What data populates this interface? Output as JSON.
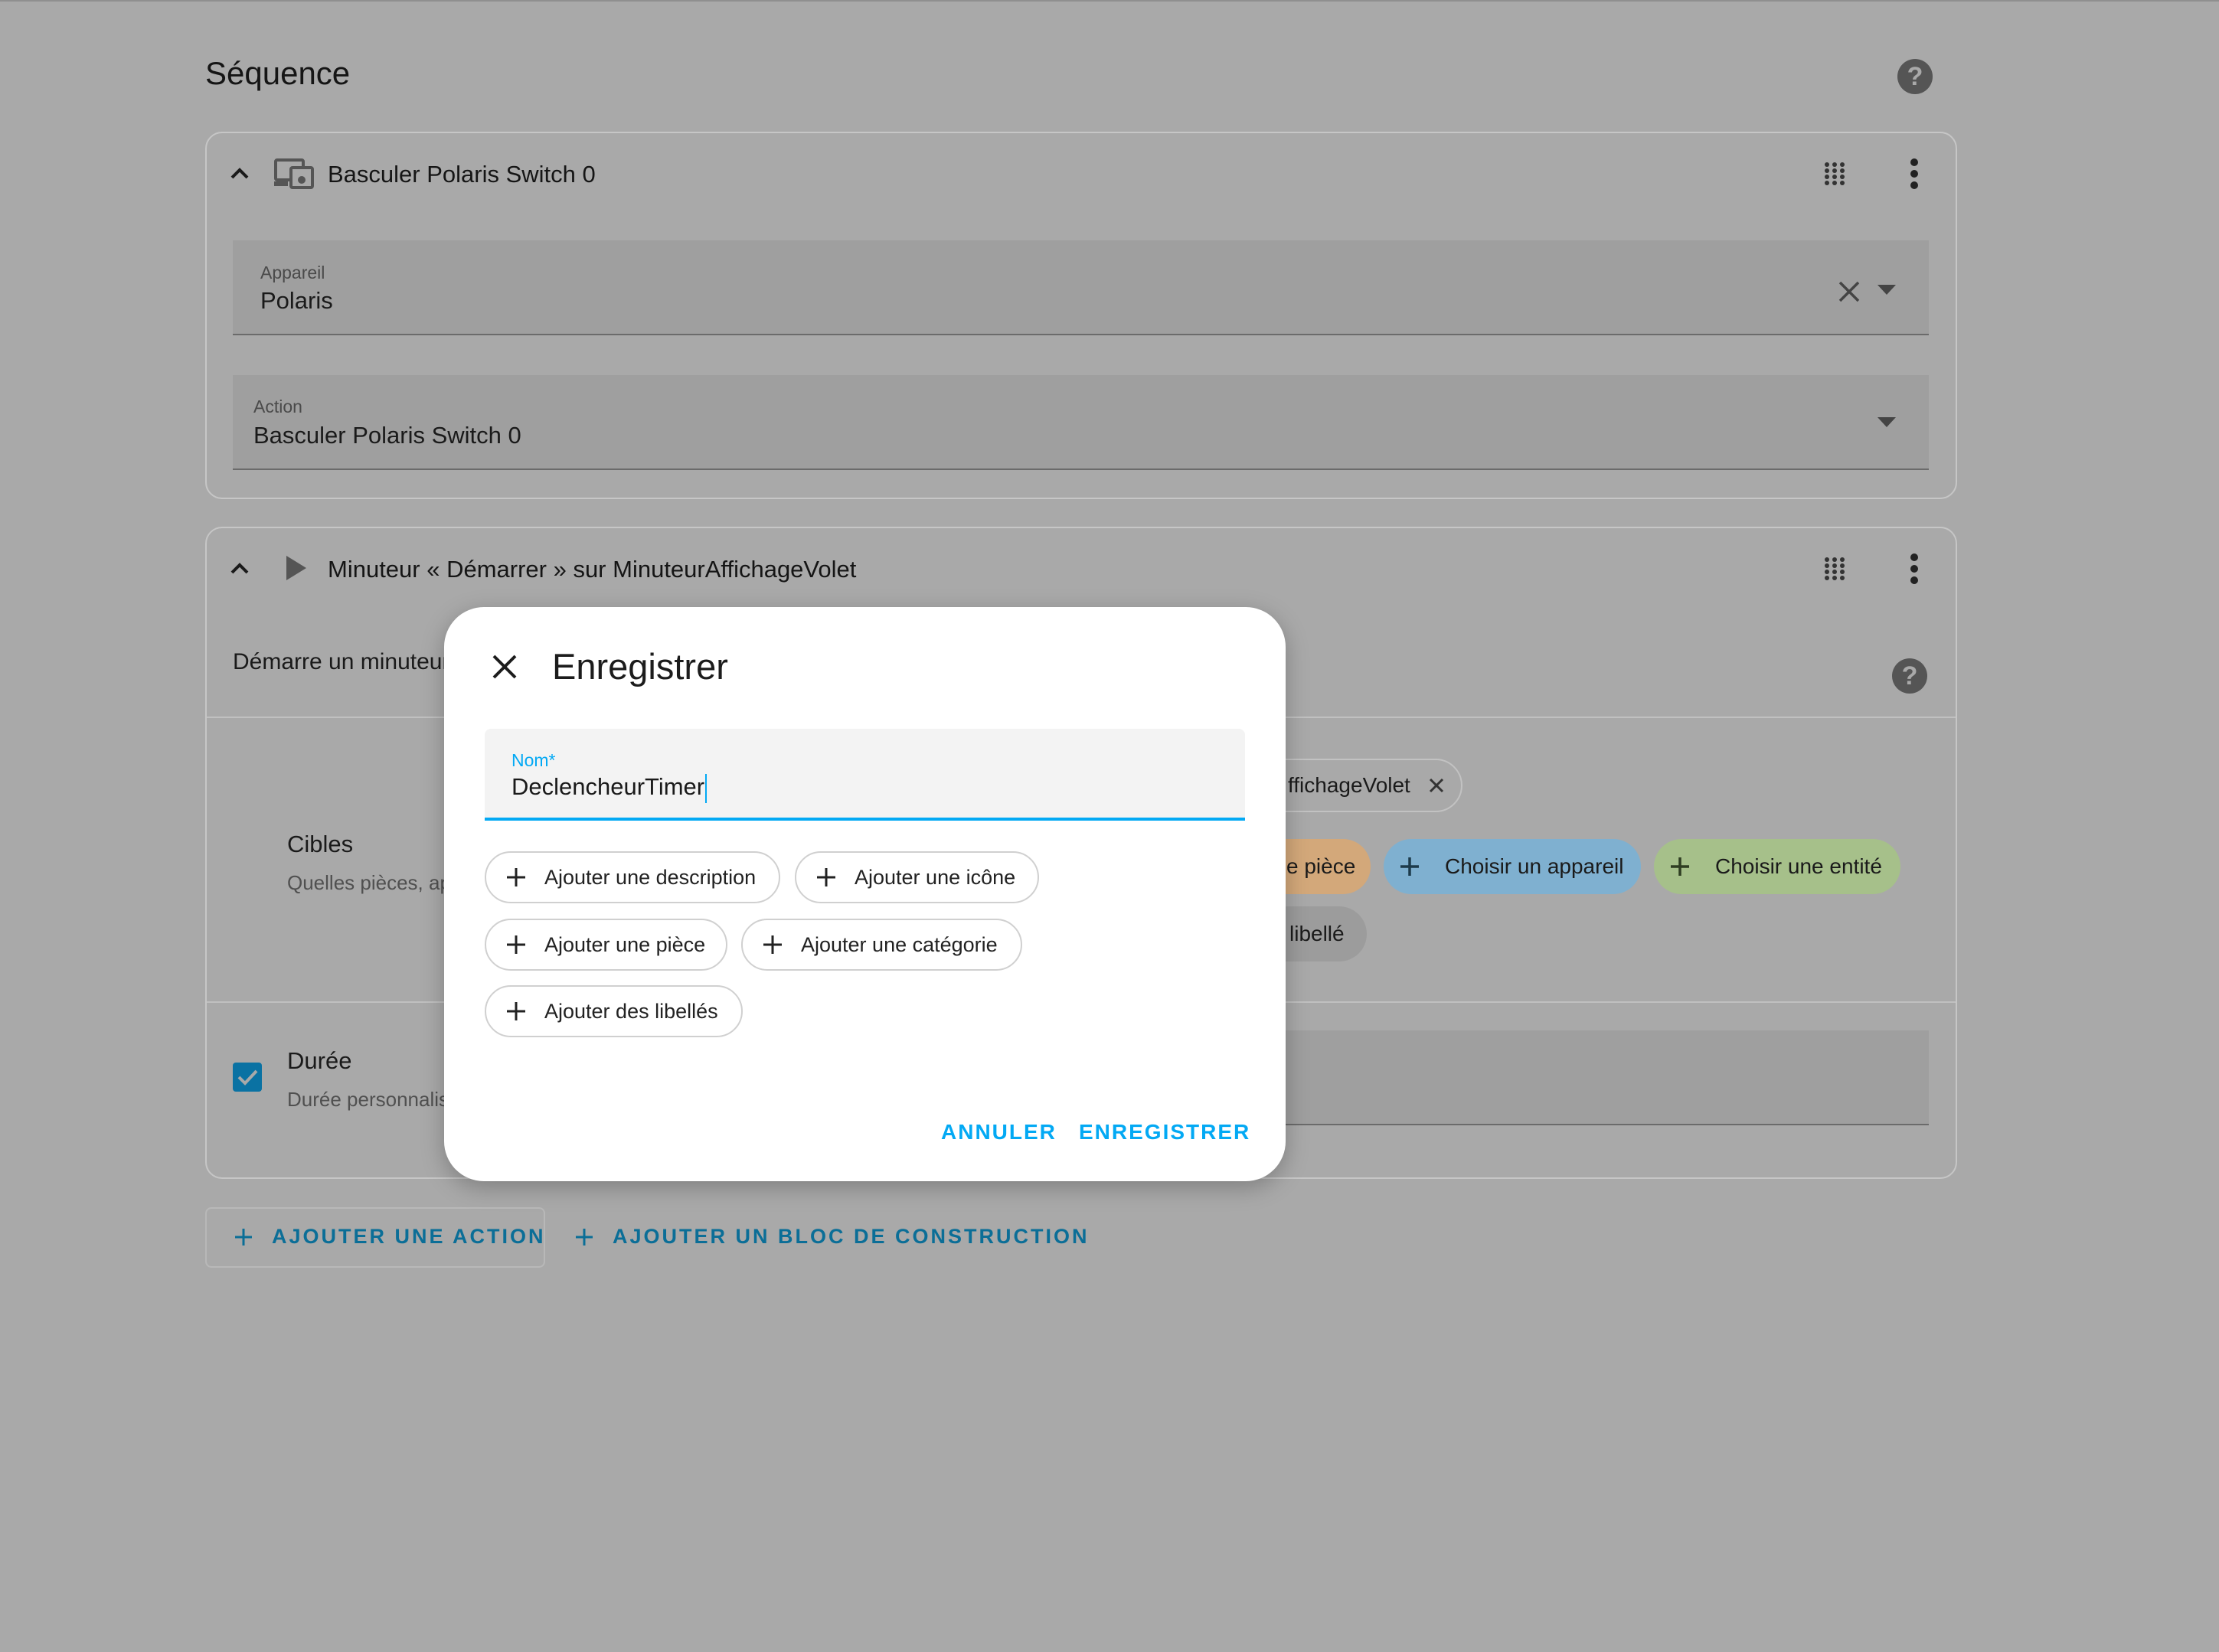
{
  "section": {
    "title": "Séquence"
  },
  "action1": {
    "title": "Basculer Polaris Switch 0",
    "device_field": {
      "label": "Appareil",
      "value": "Polaris"
    },
    "action_field": {
      "label": "Action",
      "value": "Basculer Polaris Switch 0"
    }
  },
  "action2": {
    "title": "Minuteur « Démarrer » sur MinuteurAffichageVolet",
    "description": "Démarre un minuteur",
    "targets": {
      "label": "Cibles",
      "sublabel": "Quelles pièces, ap",
      "selected_chip": "ffichageVolet",
      "chip_piece": "e pièce",
      "chip_device": "Choisir un appareil",
      "chip_entity": "Choisir une entité",
      "chip_label": "libellé"
    },
    "duration": {
      "label": "Durée",
      "sublabel": "Durée personnalis"
    }
  },
  "buttons": {
    "add_action": "AJOUTER UNE ACTION",
    "add_block": "AJOUTER UN BLOC DE CONSTRUCTION"
  },
  "dialog": {
    "title": "Enregistrer",
    "name_label": "Nom*",
    "name_value": "DeclencheurTimer",
    "pills": {
      "description": "Ajouter une description",
      "icon": "Ajouter une icône",
      "room": "Ajouter une pièce",
      "category": "Ajouter une catégorie",
      "labels": "Ajouter des libellés"
    },
    "cancel": "ANNULER",
    "save": "ENREGISTRER"
  },
  "colors": {
    "overlay_bg": "#a9a9a9",
    "accent": "#03a9f4",
    "chip_area": "#d3a87a",
    "chip_device": "#7fb0d0",
    "chip_entity": "#a6c08a",
    "chip_label": "#9c9c9c"
  }
}
